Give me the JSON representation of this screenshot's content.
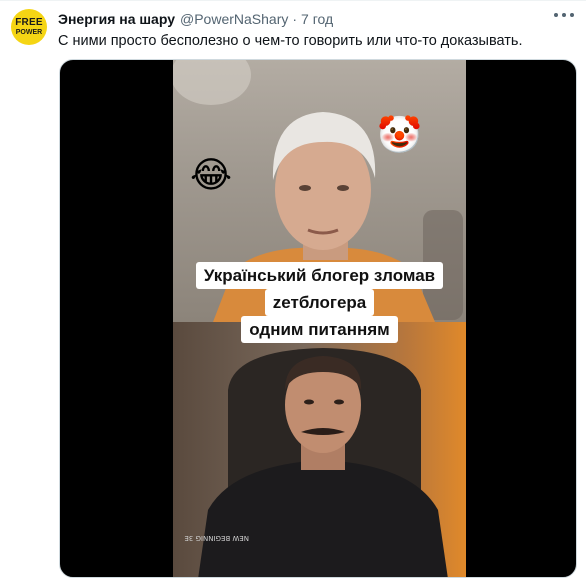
{
  "tweet": {
    "avatar_line1": "FREE",
    "avatar_line2": "POWER",
    "display_name": "Энергия на шару",
    "handle": "@PowerNaShary",
    "separator": "·",
    "time": "7 год",
    "text": "С ними просто бесполезно о чем-то говорить или что-то доказывать."
  },
  "media": {
    "caption_lines": [
      "Український блогер зломав",
      "zетблогера",
      "одним питанням"
    ],
    "emoji_laugh": "😂",
    "emoji_clown": "🤡",
    "print_text": "NEW BEGINNIG 3E"
  },
  "colors": {
    "name": "#0f1419",
    "secondary": "#536471",
    "avatar_bg": "#f5d514"
  },
  "icons": {
    "more": "more-horizontal-icon"
  }
}
